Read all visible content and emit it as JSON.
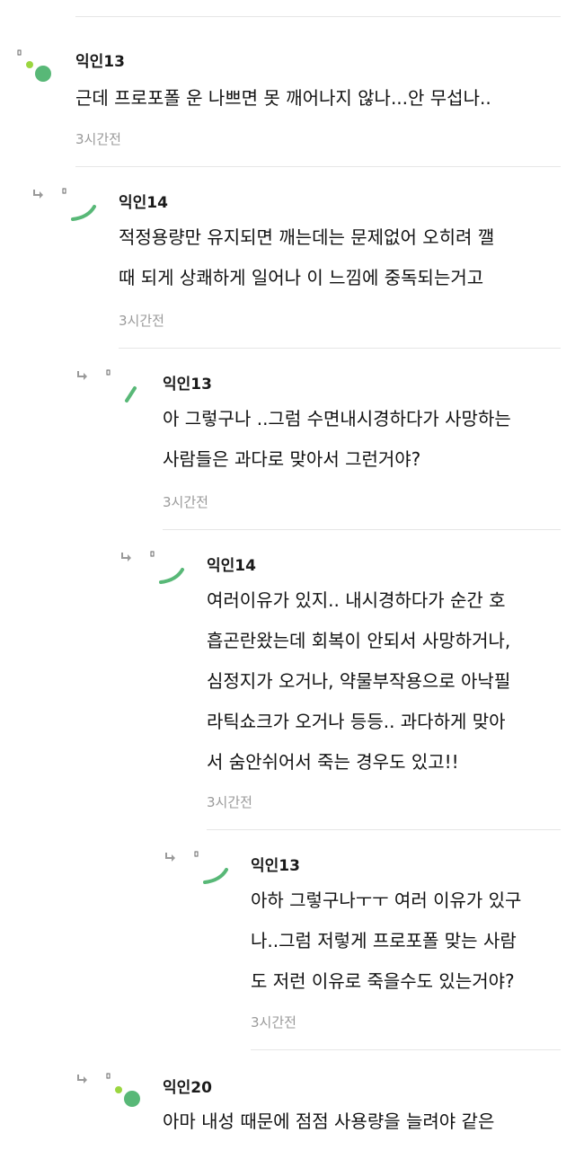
{
  "comments": [
    {
      "author": "익인13",
      "lines": [
        "근데 프로포폴 운 나쁘면 못 깨어나지 않나...안 무섭나.."
      ],
      "time": "3시간전"
    },
    {
      "author": "익인14",
      "lines": [
        "적정용량만 유지되면 깨는데는 문제없어 오히려 깰",
        "때 되게 상쾌하게 일어나 이 느낌에 중독되는거고"
      ],
      "time": "3시간전"
    },
    {
      "author": "익인13",
      "lines": [
        "아 그렇구나 ..그럼 수면내시경하다가 사망하는",
        "사람들은 과다로 맞아서 그런거야?"
      ],
      "time": "3시간전"
    },
    {
      "author": "익인14",
      "lines": [
        "여러이유가 있지.. 내시경하다가 순간 호",
        "흡곤란왔는데 회복이 안되서 사망하거나,",
        "심정지가 오거나, 약물부작용으로 아낙필",
        "라틱쇼크가 오거나 등등.. 과다하게 맞아",
        "서 숨안쉬어서 죽는 경우도 있고!!"
      ],
      "time": "3시간전"
    },
    {
      "author": "익인13",
      "lines": [
        "아하 그렇구나ㅜㅜ 여러 이유가 있구",
        "나..그럼 저렇게 프로포폴 맞는 사람",
        "도 저런 이유로 죽을수도 있는거야?"
      ],
      "time": "3시간전"
    },
    {
      "author": "익인20",
      "lines": [
        "아마 내성 때문에 점점 사용량을 늘려야 같은"
      ],
      "time": ""
    }
  ],
  "colors": {
    "avatar_green": "#58b877",
    "avatar_lime": "#9bd640",
    "divider": "#e6e6e6",
    "meta_gray": "#9a9a9a"
  },
  "icons": {
    "reply": "reply-arrow-icon",
    "avatar": "avatar-icon"
  }
}
